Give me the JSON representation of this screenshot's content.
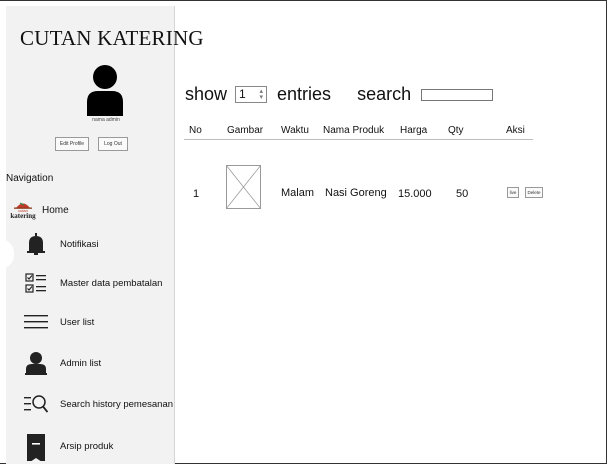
{
  "brand": {
    "title": "CUTAN KATERING"
  },
  "profile": {
    "name": "nama admin",
    "edit_label": "Edit Profile",
    "logout_label": "Log Out"
  },
  "nav": {
    "title": "Navigation",
    "items": [
      {
        "label": "Home",
        "icon": "katering-logo-icon"
      },
      {
        "label": "Notifikasi",
        "icon": "bell-icon"
      },
      {
        "label": "Master data pembatalan",
        "icon": "checklist-icon"
      },
      {
        "label": "User list",
        "icon": "list-lines-icon"
      },
      {
        "label": "Admin list",
        "icon": "user-icon"
      },
      {
        "label": "Search history pemesanan",
        "icon": "search-list-icon"
      },
      {
        "label": "Arsip produk",
        "icon": "bookmark-icon"
      }
    ]
  },
  "controls": {
    "show_label": "show",
    "entries_value": "1",
    "entries_label": "entries",
    "search_label": "search",
    "search_value": ""
  },
  "table": {
    "headers": [
      "No",
      "Gambar",
      "Waktu",
      "Nama Produk",
      "Harga",
      "Qty",
      "Aksi"
    ],
    "rows": [
      {
        "no": "1",
        "waktu": "Malam",
        "nama_produk": "Nasi Goreng",
        "harga": "15.000",
        "qty": "50",
        "edit_label": "live",
        "delete_label": "Delete"
      }
    ]
  },
  "logo_text": {
    "top": "cutan",
    "bottom": "katering"
  }
}
